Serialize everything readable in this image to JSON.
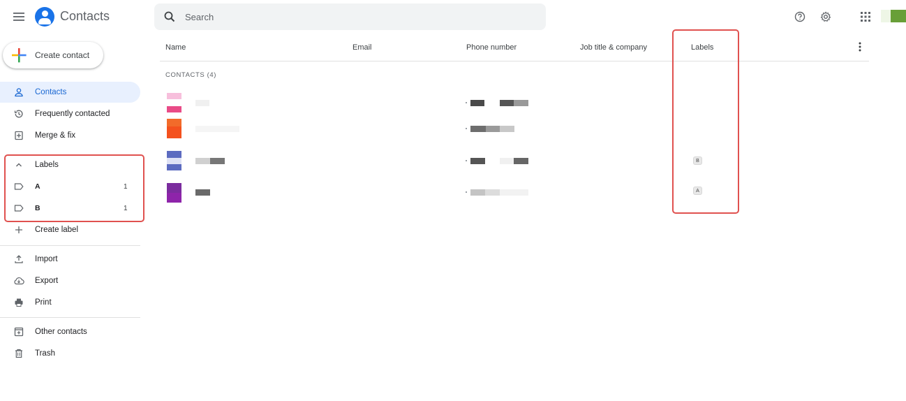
{
  "app": {
    "title": "Contacts"
  },
  "search": {
    "placeholder": "Search"
  },
  "sidebar": {
    "create_label": "Create contact",
    "items": [
      {
        "label": "Contacts",
        "icon": "person-icon",
        "active": true
      },
      {
        "label": "Frequently contacted",
        "icon": "history-icon"
      },
      {
        "label": "Merge & fix",
        "icon": "merge-icon"
      }
    ],
    "labels_header": "Labels",
    "labels": [
      {
        "label": "A",
        "count": "1"
      },
      {
        "label": "B",
        "count": "1"
      }
    ],
    "create_label_text": "Create label",
    "tools": [
      {
        "label": "Import",
        "icon": "upload-icon"
      },
      {
        "label": "Export",
        "icon": "cloud-download-icon"
      },
      {
        "label": "Print",
        "icon": "print-icon"
      }
    ],
    "other": [
      {
        "label": "Other contacts",
        "icon": "other-contacts-icon"
      },
      {
        "label": "Trash",
        "icon": "trash-icon"
      }
    ]
  },
  "table": {
    "columns": [
      "Name",
      "Email",
      "Phone number",
      "Job title & company",
      "Labels"
    ],
    "section_title": "CONTACTS (4)",
    "rows": [
      {
        "avatar_colors": [
          "#f7bfdc",
          "#ffffff",
          "#e94b87"
        ],
        "label_chip": ""
      },
      {
        "avatar_colors": [
          "#f26b2a",
          "#f4511e"
        ],
        "label_chip": ""
      },
      {
        "avatar_colors": [
          "#5c6bc0",
          "#dfe2f5",
          "#5c6bc0"
        ],
        "label_chip": "B"
      },
      {
        "avatar_colors": [
          "#7b2c9e",
          "#8e24aa"
        ],
        "label_chip": "A"
      }
    ]
  },
  "colors": {
    "accent": "#1a73e8",
    "highlight": "#e0514f",
    "active_bg": "#e8f0fe"
  }
}
